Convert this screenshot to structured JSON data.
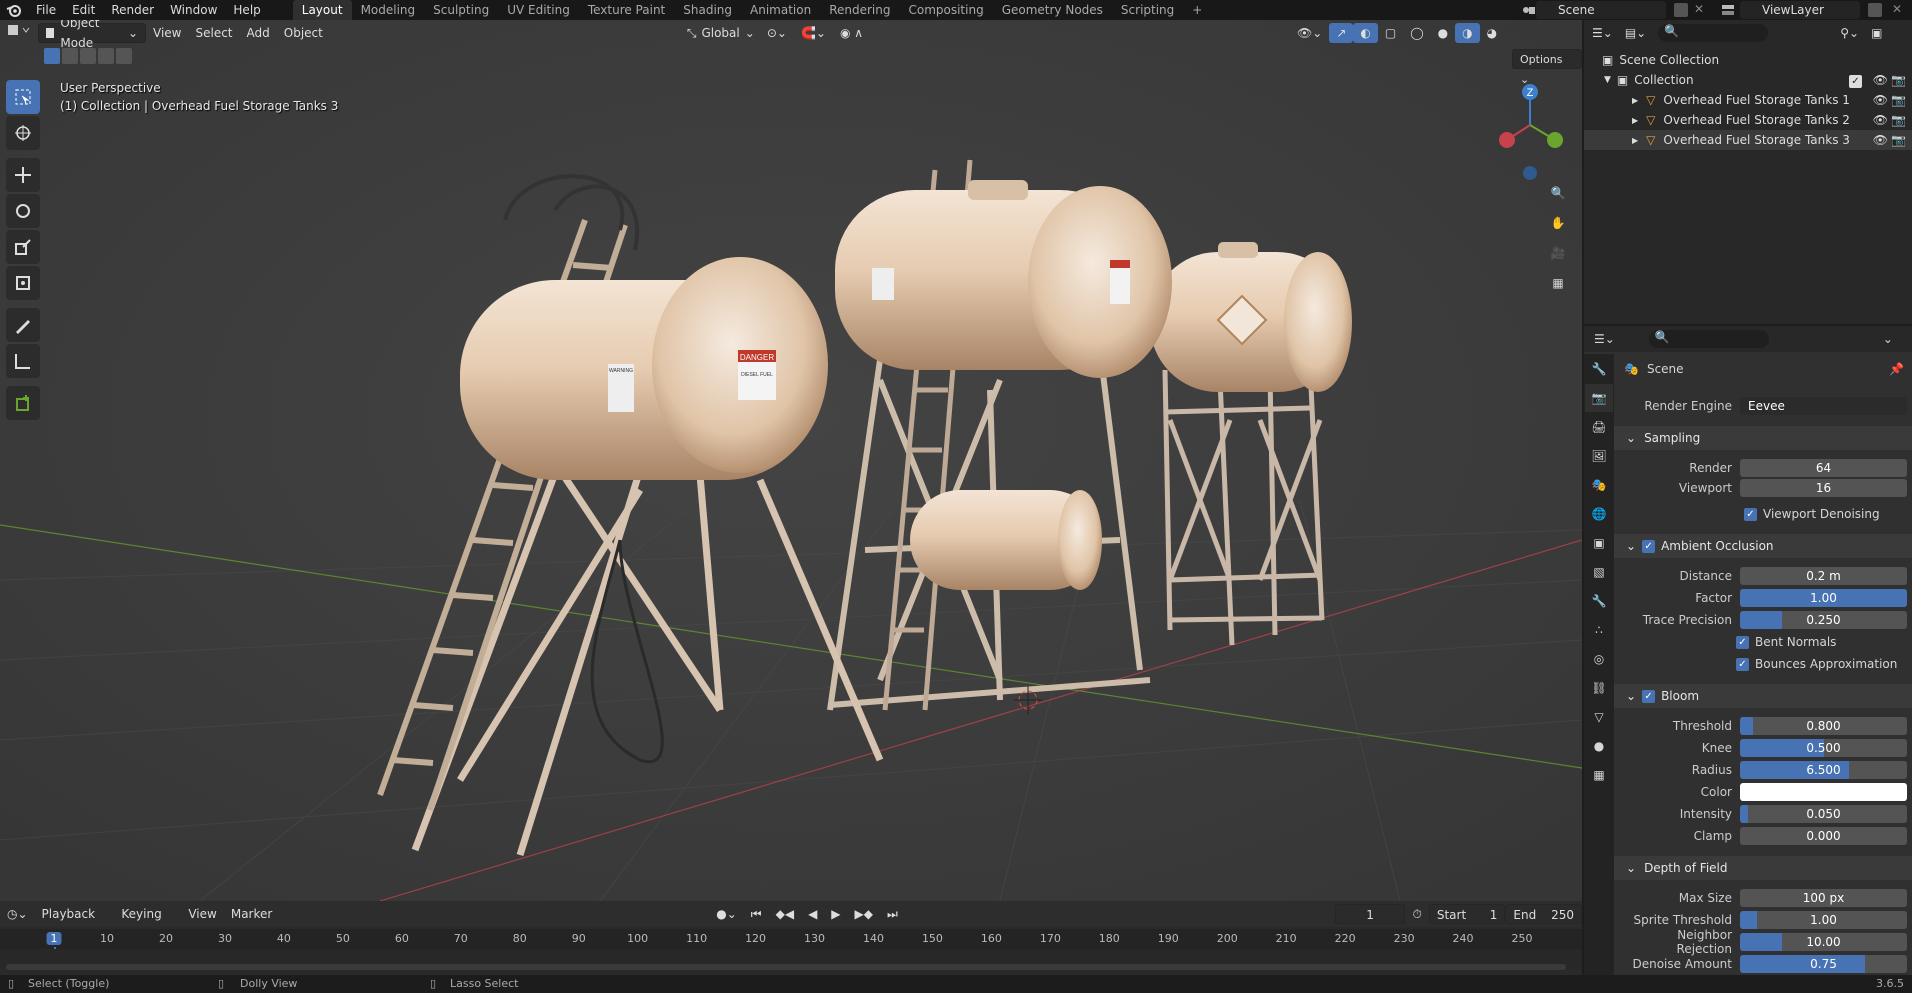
{
  "topbar": {
    "menus": [
      "File",
      "Edit",
      "Render",
      "Window",
      "Help"
    ],
    "workspaces": [
      "Layout",
      "Modeling",
      "Sculpting",
      "UV Editing",
      "Texture Paint",
      "Shading",
      "Animation",
      "Rendering",
      "Compositing",
      "Geometry Nodes",
      "Scripting"
    ],
    "active_workspace": "Layout",
    "scene": "Scene",
    "view_layer": "ViewLayer"
  },
  "viewport": {
    "mode": "Object Mode",
    "menus": [
      "View",
      "Select",
      "Add",
      "Object"
    ],
    "orientation": "Global",
    "options_label": "Options",
    "overlay_title": "User Perspective",
    "overlay_sub": "(1) Collection | Overhead Fuel Storage Tanks 3",
    "gizmo_z": "Z",
    "tank_labels": {
      "danger": "DANGER",
      "diesel": "DIESEL FUEL",
      "warning": "WARNING"
    }
  },
  "outliner": {
    "root": "Scene Collection",
    "collection": "Collection",
    "objects": [
      "Overhead Fuel Storage Tanks 1",
      "Overhead Fuel Storage Tanks 2",
      "Overhead Fuel Storage Tanks 3"
    ]
  },
  "properties": {
    "context": "Scene",
    "render_engine_label": "Render Engine",
    "render_engine": "Eevee",
    "sampling": {
      "title": "Sampling",
      "render_label": "Render",
      "render": "64",
      "viewport_label": "Viewport",
      "viewport": "16",
      "denoise": "Viewport Denoising"
    },
    "ao": {
      "title": "Ambient Occlusion",
      "distance_label": "Distance",
      "distance": "0.2 m",
      "factor_label": "Factor",
      "factor": "1.00",
      "factor_fill": 1.0,
      "trace_label": "Trace Precision",
      "trace": "0.250",
      "trace_fill": 0.25,
      "bent": "Bent Normals",
      "bounces": "Bounces Approximation"
    },
    "bloom": {
      "title": "Bloom",
      "threshold_label": "Threshold",
      "threshold": "0.800",
      "threshold_fill": 0.08,
      "knee_label": "Knee",
      "knee": "0.500",
      "knee_fill": 0.5,
      "radius_label": "Radius",
      "radius": "6.500",
      "radius_fill": 0.65,
      "color_label": "Color",
      "color": "#ffffff",
      "intensity_label": "Intensity",
      "intensity": "0.050",
      "intensity_fill": 0.05,
      "clamp_label": "Clamp",
      "clamp": "0.000"
    },
    "dof": {
      "title": "Depth of Field",
      "maxsize_label": "Max Size",
      "maxsize": "100 px",
      "sprite_label": "Sprite Threshold",
      "sprite": "1.00",
      "sprite_fill": 0.1,
      "neighbor_label": "Neighbor Rejection",
      "neighbor": "10.00",
      "neighbor_fill": 0.25,
      "denoise_label": "Denoise Amount",
      "denoise": "0.75",
      "denoise_fill": 0.75
    }
  },
  "timeline": {
    "menus": [
      "Playback",
      "Keying",
      "View",
      "Marker"
    ],
    "current_frame": "1",
    "start_label": "Start",
    "start": "1",
    "end_label": "End",
    "end": "250",
    "ticks": [
      "1",
      "10",
      "20",
      "30",
      "40",
      "50",
      "60",
      "70",
      "80",
      "90",
      "100",
      "110",
      "120",
      "130",
      "140",
      "150",
      "160",
      "170",
      "180",
      "190",
      "200",
      "210",
      "220",
      "230",
      "240",
      "250"
    ]
  },
  "statusbar": {
    "select": "Select (Toggle)",
    "dolly": "Dolly View",
    "lasso": "Lasso Select",
    "version": "3.6.5"
  },
  "colors": {
    "accent": "#4772b3",
    "x_axis": "#c8424e",
    "y_axis": "#6aa52d",
    "z_axis": "#3d80d0"
  }
}
